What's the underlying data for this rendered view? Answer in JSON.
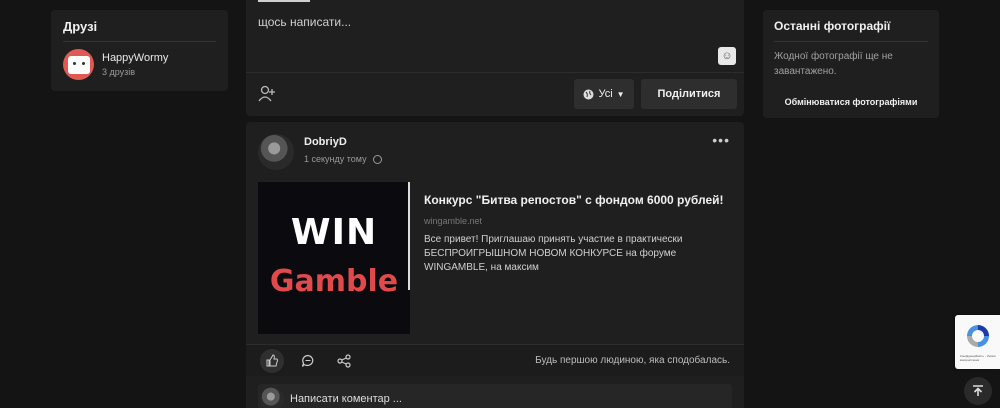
{
  "friends": {
    "title": "Друзі",
    "items": [
      {
        "name": "HappyWormy",
        "count": "3 друзів"
      }
    ]
  },
  "composer": {
    "placeholder": "щось написати...",
    "audience": "Усі",
    "share_label": "Поділитися"
  },
  "post": {
    "author": "DobriyD",
    "time": "1 секунду тому",
    "more": "•••",
    "link": {
      "image_line1": "WIN",
      "image_line2": "Gamble",
      "title": "Конкурс \"Битва репостов\" с фондом 6000 рублей!",
      "domain": "wingamble.net",
      "description": "Все привет! Приглашаю принять участие в практически БЕСПРОИГРЫШНОМ НОВОМ КОНКУРСЕ на форуме WINGAMBLE, на максим"
    },
    "likes_text": "Будь першою людиною, яка сподобалась.",
    "comment_placeholder": "Написати коментар ..."
  },
  "photos": {
    "title": "Останні фотографії",
    "empty": "Жодної фотографії ще не завантажено.",
    "exchange_label": "Обмінюватися фотографіями"
  },
  "recaptcha": {
    "small_text": "Конфіденційність - Умови використання"
  },
  "colors": {
    "background": "#141414",
    "card": "#1f1f1f",
    "gamble_red": "#e04a4a"
  }
}
